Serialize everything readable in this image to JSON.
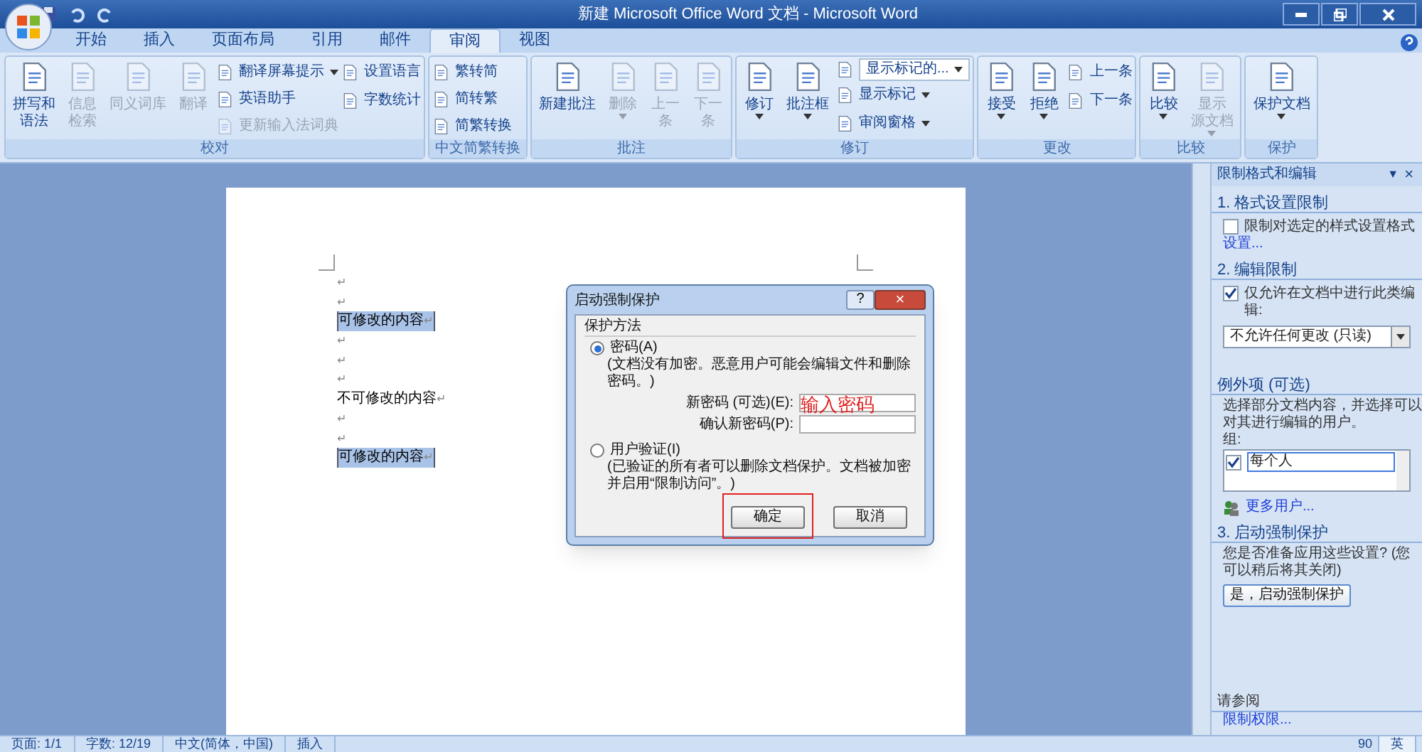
{
  "window": {
    "title": "新建 Microsoft Office Word 文档 - Microsoft Word"
  },
  "tabs": [
    {
      "label": "开始",
      "selected": false
    },
    {
      "label": "插入",
      "selected": false
    },
    {
      "label": "页面布局",
      "selected": false
    },
    {
      "label": "引用",
      "selected": false
    },
    {
      "label": "邮件",
      "selected": false
    },
    {
      "label": "审阅",
      "selected": true
    },
    {
      "label": "视图",
      "selected": false
    }
  ],
  "ribbon": {
    "groups": [
      {
        "name": "校对",
        "items": [
          {
            "kind": "large",
            "lines": [
              "拼写和",
              "语法"
            ],
            "disabled": false,
            "dropdown": false
          },
          {
            "kind": "large",
            "lines": [
              "信息",
              "检索"
            ],
            "disabled": true,
            "dropdown": false
          },
          {
            "kind": "large",
            "lines": [
              "同义词库"
            ],
            "disabled": true,
            "dropdown": false
          },
          {
            "kind": "large",
            "lines": [
              "翻译"
            ],
            "disabled": true,
            "dropdown": false
          },
          {
            "kind": "stack",
            "items": [
              {
                "label": "翻译屏幕提示",
                "disabled": false,
                "dropdown": true
              },
              {
                "label": "英语助手",
                "disabled": false,
                "dropdown": false
              },
              {
                "label": "更新输入法词典",
                "disabled": true,
                "dropdown": false
              }
            ]
          },
          {
            "kind": "stack",
            "items": [
              {
                "label": "设置语言",
                "disabled": false,
                "dropdown": false
              },
              {
                "label": "字数统计",
                "disabled": false,
                "dropdown": false
              }
            ]
          }
        ]
      },
      {
        "name": "中文简繁转换",
        "items": [
          {
            "kind": "stack",
            "items": [
              {
                "label": "繁转简",
                "disabled": false,
                "dropdown": false
              },
              {
                "label": "简转繁",
                "disabled": false,
                "dropdown": false
              },
              {
                "label": "简繁转换",
                "disabled": false,
                "dropdown": false
              }
            ]
          }
        ]
      },
      {
        "name": "批注",
        "items": [
          {
            "kind": "large",
            "lines": [
              "新建批注"
            ],
            "disabled": false,
            "dropdown": false
          },
          {
            "kind": "large",
            "lines": [
              "删除"
            ],
            "disabled": true,
            "dropdown": true
          },
          {
            "kind": "large",
            "lines": [
              "上一",
              "条"
            ],
            "disabled": true,
            "dropdown": false
          },
          {
            "kind": "large",
            "lines": [
              "下一",
              "条"
            ],
            "disabled": true,
            "dropdown": false
          }
        ]
      },
      {
        "name": "修订",
        "items": [
          {
            "kind": "large",
            "lines": [
              "修订"
            ],
            "disabled": false,
            "dropdown": true
          },
          {
            "kind": "large",
            "lines": [
              "批注框"
            ],
            "disabled": false,
            "dropdown": true
          },
          {
            "kind": "stack",
            "items": [
              {
                "label": "显示标记的...",
                "disabled": false,
                "dropdown": true,
                "select": true
              },
              {
                "label": "显示标记",
                "disabled": false,
                "dropdown": true
              },
              {
                "label": "审阅窗格",
                "disabled": false,
                "dropdown": true
              }
            ]
          }
        ]
      },
      {
        "name": "更改",
        "items": [
          {
            "kind": "large",
            "lines": [
              "接受"
            ],
            "disabled": false,
            "dropdown": true
          },
          {
            "kind": "large",
            "lines": [
              "拒绝"
            ],
            "disabled": false,
            "dropdown": true
          },
          {
            "kind": "stack",
            "items": [
              {
                "label": "上一条",
                "disabled": false,
                "dropdown": false
              },
              {
                "label": "下一条",
                "disabled": false,
                "dropdown": false
              }
            ]
          }
        ]
      },
      {
        "name": "比较",
        "items": [
          {
            "kind": "large",
            "lines": [
              "比较"
            ],
            "disabled": false,
            "dropdown": true
          },
          {
            "kind": "large",
            "lines": [
              "显示",
              "源文档"
            ],
            "disabled": true,
            "dropdown": true
          }
        ]
      },
      {
        "name": "保护",
        "items": [
          {
            "kind": "large",
            "lines": [
              "保护文档"
            ],
            "disabled": false,
            "dropdown": true
          }
        ]
      }
    ]
  },
  "document": {
    "lines": [
      {
        "mark": "↵",
        "highlighted": false
      },
      {
        "mark": "↵",
        "highlighted": false
      },
      {
        "text": "可修改的内容",
        "mark": "↵",
        "highlighted": true
      },
      {
        "mark": "↵",
        "highlighted": false
      },
      {
        "mark": "↵",
        "highlighted": false
      },
      {
        "mark": "↵",
        "highlighted": false
      },
      {
        "text": "不可修改的内容",
        "mark": "↵",
        "highlighted": false
      },
      {
        "mark": "↵",
        "highlighted": false
      },
      {
        "mark": "↵",
        "highlighted": false
      },
      {
        "text": "可修改的内容",
        "mark": "↵",
        "highlighted": true
      }
    ]
  },
  "dialog": {
    "title": "启动强制保护",
    "help": "?",
    "close": "×",
    "group": "保护方法",
    "options": [
      {
        "label": "密码(A)",
        "selected": true,
        "description": "(文档没有加密。恶意用户可能会编辑文件和删除密码。)"
      },
      {
        "label": "用户验证(I)",
        "selected": false,
        "description": "(已验证的所有者可以删除文档保护。文档被加密并启用“限制访问”。)"
      }
    ],
    "fields": [
      {
        "label": "新密码 (可选)(E):",
        "value": "输入密码"
      },
      {
        "label": "确认新密码(P):"
      }
    ],
    "buttons": [
      {
        "label": "确定",
        "highlighted": true
      },
      {
        "label": "取消",
        "highlighted": false
      }
    ]
  },
  "task_pane": {
    "title": "限制格式和编辑",
    "menu": "▼",
    "close": "×",
    "section1": {
      "heading": "1. 格式设置限制",
      "checkbox": {
        "label": "限制对选定的样式设置格式",
        "checked": false
      },
      "link": "设置..."
    },
    "section2": {
      "heading": "2. 编辑限制",
      "checkbox": {
        "label": "仅允许在文档中进行此类编辑:",
        "checked": true
      },
      "select": "不允许任何更改 (只读)",
      "exceptions": {
        "heading": "例外项 (可选)",
        "text": "选择部分文档内容，并选择可以对其进行编辑的用户。",
        "groups_label": "组:",
        "groups": [
          {
            "label": "每个人",
            "checked": true
          }
        ],
        "link": "更多用户..."
      }
    },
    "section3": {
      "heading": "3. 启动强制保护",
      "text": "您是否准备应用这些设置? (您可以稍后将其关闭)",
      "button": "是，启动强制保护"
    },
    "see_also": {
      "heading": "请参阅",
      "link": "限制权限..."
    }
  },
  "status_bar": {
    "items": [
      "页面: 1/1",
      "字数: 12/19",
      "中文(简体，中国)",
      "插入"
    ],
    "zoom": "90",
    "ime": "英"
  }
}
